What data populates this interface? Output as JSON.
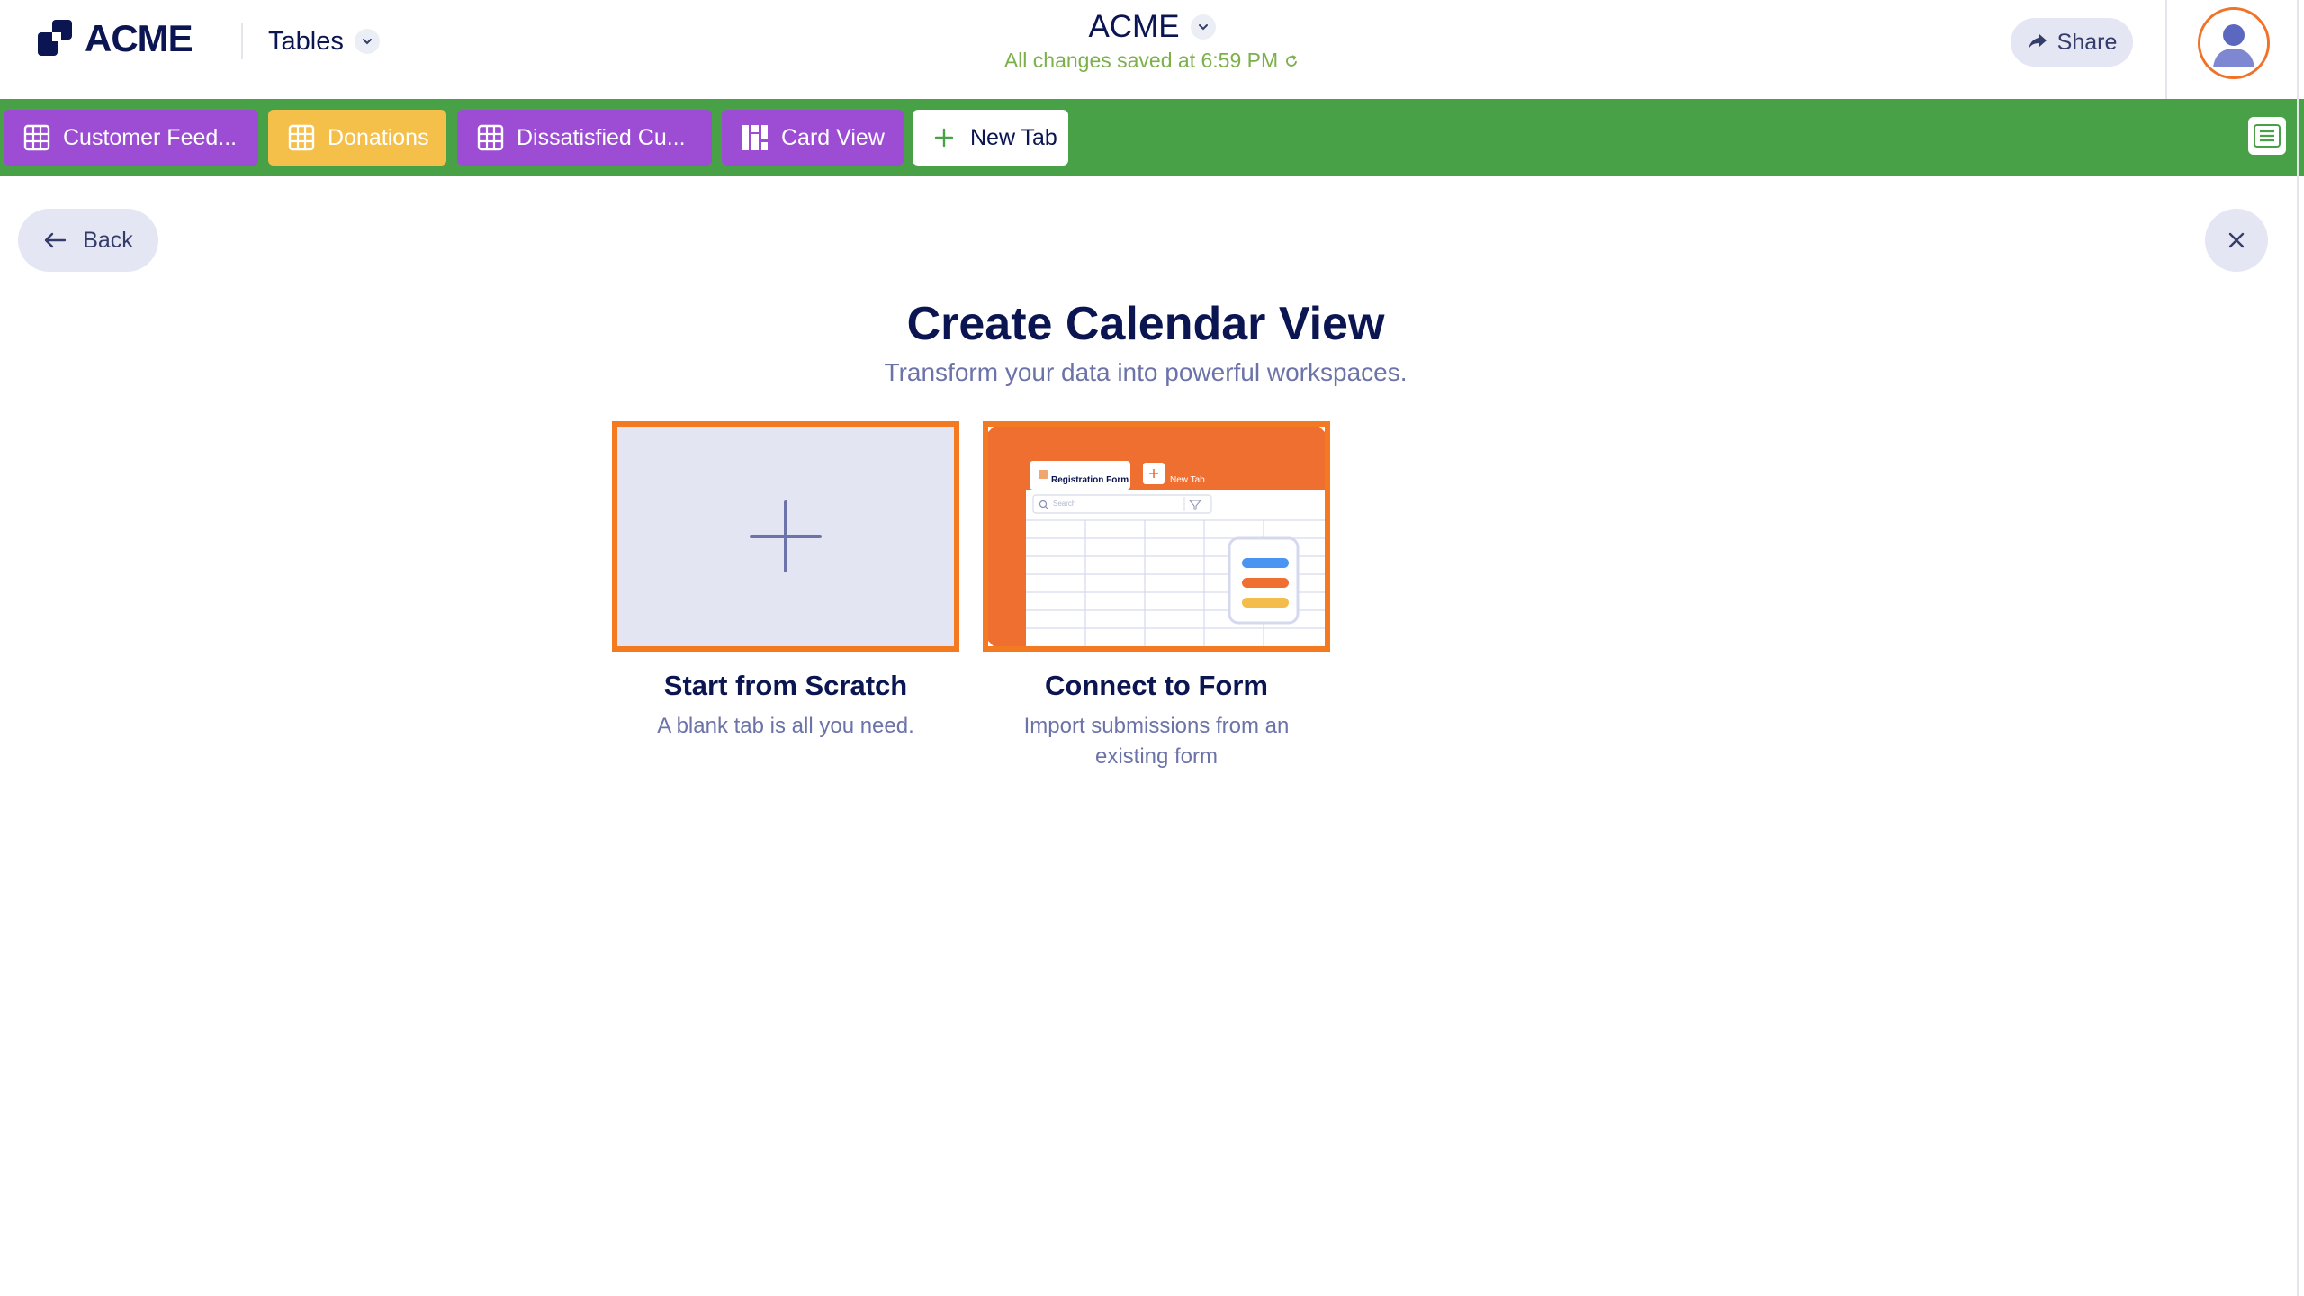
{
  "header": {
    "logo_text": "ACME",
    "app_switch_label": "Tables",
    "doc_title": "ACME",
    "save_status": "All changes saved at 6:59 PM",
    "share_label": "Share"
  },
  "tabs": [
    {
      "label": "Customer Feed...",
      "color": "#9c4dd3",
      "icon": "table-grid-icon"
    },
    {
      "label": "Donations",
      "color": "#f5c04a",
      "icon": "table-grid-icon"
    },
    {
      "label": "Dissatisfied Cu...",
      "color": "#9c4dd3",
      "icon": "table-grid-icon"
    },
    {
      "label": "Card View",
      "color": "#9c4dd3",
      "icon": "card-view-icon"
    },
    {
      "label": "New Tab",
      "color": "#ffffff",
      "icon": "plus-icon"
    }
  ],
  "content": {
    "back_label": "Back",
    "title": "Create Calendar View",
    "subtitle": "Transform your data into powerful workspaces.",
    "options": [
      {
        "title": "Start from Scratch",
        "description": "A blank tab is all you need."
      },
      {
        "title": "Connect to Form",
        "description": "Import submissions from an existing form",
        "preview": {
          "tab_label": "Registration Form",
          "new_tab_label": "New Tab",
          "search_placeholder": "Search"
        }
      }
    ]
  },
  "colors": {
    "brand_navy": "#0a1551",
    "tabbar_green": "#48a146",
    "accent_orange": "#f37a20",
    "status_green": "#7bb04a"
  }
}
